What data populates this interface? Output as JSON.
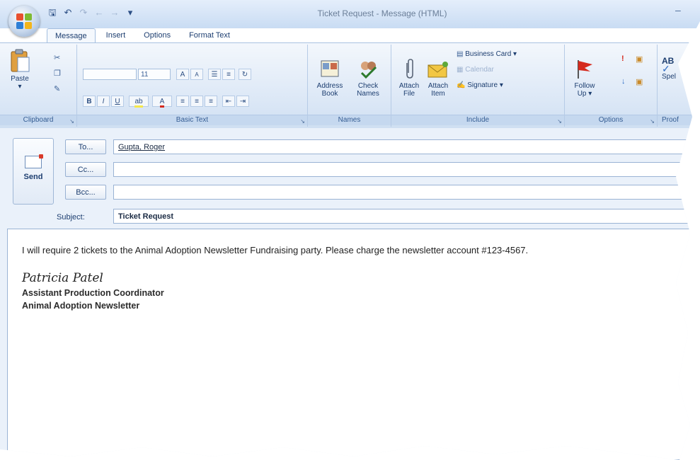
{
  "window": {
    "title": "Ticket Request - Message (HTML)",
    "minimize_glyph": "–"
  },
  "quick_access": [
    "save-icon",
    "undo-icon",
    "redo-icon",
    "previous-icon",
    "next-icon",
    "customize-icon"
  ],
  "tabs": [
    "Message",
    "Insert",
    "Options",
    "Format Text"
  ],
  "ribbon": {
    "clipboard": {
      "paste_label": "Paste",
      "group_label": "Clipboard"
    },
    "basic_text": {
      "font_size": "11",
      "bold": "B",
      "italic": "I",
      "underline": "U",
      "group_label": "Basic Text"
    },
    "names": {
      "address_book": [
        "Address",
        "Book"
      ],
      "check_names": [
        "Check",
        "Names"
      ],
      "group_label": "Names"
    },
    "include": {
      "attach_file": [
        "Attach",
        "File"
      ],
      "attach_item": [
        "Attach",
        "Item"
      ],
      "business_card": "Business Card",
      "calendar": "Calendar",
      "signature": "Signature",
      "group_label": "Include"
    },
    "options": {
      "follow_up": [
        "Follow",
        "Up"
      ],
      "group_label": "Options"
    },
    "proofing": {
      "spelling": "Spel",
      "group_label": "Proof"
    }
  },
  "compose": {
    "send_label": "Send",
    "to_button": "To...",
    "cc_button": "Cc...",
    "bcc_button": "Bcc...",
    "subject_label": "Subject:",
    "to_value": "Gupta, Roger",
    "cc_value": "",
    "bcc_value": "",
    "subject_value": "Ticket Request"
  },
  "message": {
    "body": "I will require 2 tickets to the Animal Adoption Newsletter Fundraising party. Please charge the newsletter account #123-4567.",
    "signature_name": "Patricia Patel",
    "signature_title": "Assistant Production Coordinator",
    "signature_org": "Animal Adoption Newsletter"
  },
  "colors": {
    "ribbon_bg": "#dbe7f6",
    "titlebar_bg": "#c9dcf3",
    "accent_text": "#1d3e70",
    "flag_red": "#d52a1e"
  }
}
